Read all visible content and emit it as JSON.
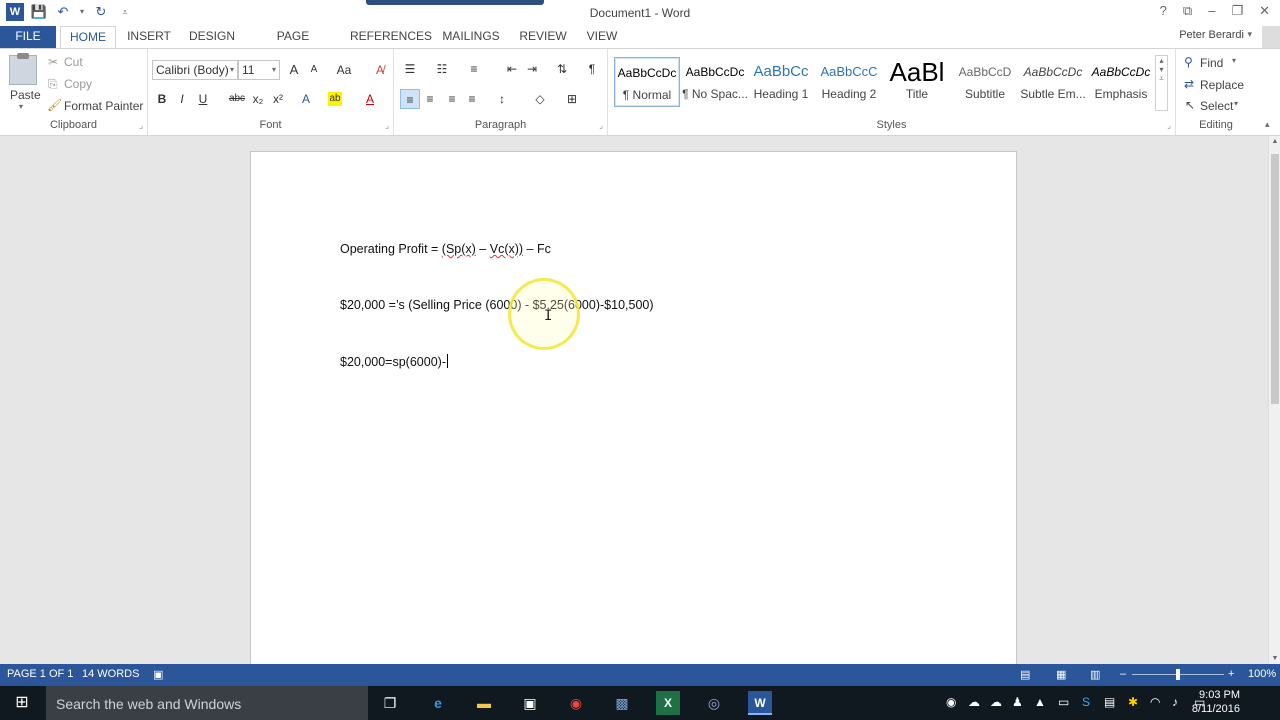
{
  "window": {
    "title": "Document1 - Word",
    "controls": [
      "?",
      "⧉",
      "–",
      "❐",
      "✕"
    ]
  },
  "qat": {
    "word_logo": "W"
  },
  "tabs": [
    {
      "label": "FILE"
    },
    {
      "label": "HOME"
    },
    {
      "label": "INSERT"
    },
    {
      "label": "DESIGN"
    },
    {
      "label": "PAGE LAYOUT"
    },
    {
      "label": "REFERENCES"
    },
    {
      "label": "MAILINGS"
    },
    {
      "label": "REVIEW"
    },
    {
      "label": "VIEW"
    }
  ],
  "user": "Peter Berardi",
  "clipboard": {
    "paste": "Paste",
    "cut": "Cut",
    "copy": "Copy",
    "format_painter": "Format Painter",
    "group_label": "Clipboard"
  },
  "font": {
    "name": "Calibri (Body)",
    "size": "11",
    "group_label": "Font",
    "bold": "B",
    "italic": "I",
    "underline": "U",
    "strike": "abc",
    "subscript": "x₂",
    "superscript": "x²",
    "grow": "A",
    "shrink": "A",
    "case": "Aa"
  },
  "paragraph": {
    "group_label": "Paragraph",
    "pilcrow": "¶"
  },
  "styles": {
    "group_label": "Styles",
    "items": [
      {
        "sample": "AaBbCcDc",
        "name": "¶ Normal"
      },
      {
        "sample": "AaBbCcDc",
        "name": "¶ No Spac..."
      },
      {
        "sample": "AaBbCc",
        "name": "Heading 1"
      },
      {
        "sample": "AaBbCcC",
        "name": "Heading 2"
      },
      {
        "sample": "AaBl",
        "name": "Title"
      },
      {
        "sample": "AaBbCcD",
        "name": "Subtitle"
      },
      {
        "sample": "AaBbCcDc",
        "name": "Subtle Em..."
      },
      {
        "sample": "AaBbCcDc",
        "name": "Emphasis"
      }
    ]
  },
  "editing": {
    "group_label": "Editing",
    "find": "Find",
    "replace": "Replace",
    "select": "Select"
  },
  "document": {
    "lines": [
      {
        "text_before": "Operating Profit = ",
        "sp": "(Sp(x)",
        "mid": " – ",
        "vc": "Vc(x))",
        "after": " – Fc"
      },
      {
        "text": "$20,000 =’s (Selling Price (6000) - $5.25(6000)-$10,500)"
      },
      {
        "text": "$20,000=sp(6000)-"
      }
    ]
  },
  "status": {
    "page": "PAGE 1 OF 1",
    "words": "14 WORDS",
    "zoom": "100%",
    "zoom_level": 100
  },
  "taskbar": {
    "search_placeholder": "Search the web and Windows",
    "time": "9:03 PM",
    "date": "8/11/2016"
  },
  "colors": {
    "accent": "#2b579a",
    "taskbar": "#101820",
    "highlight_ring": "#f5e63c"
  }
}
